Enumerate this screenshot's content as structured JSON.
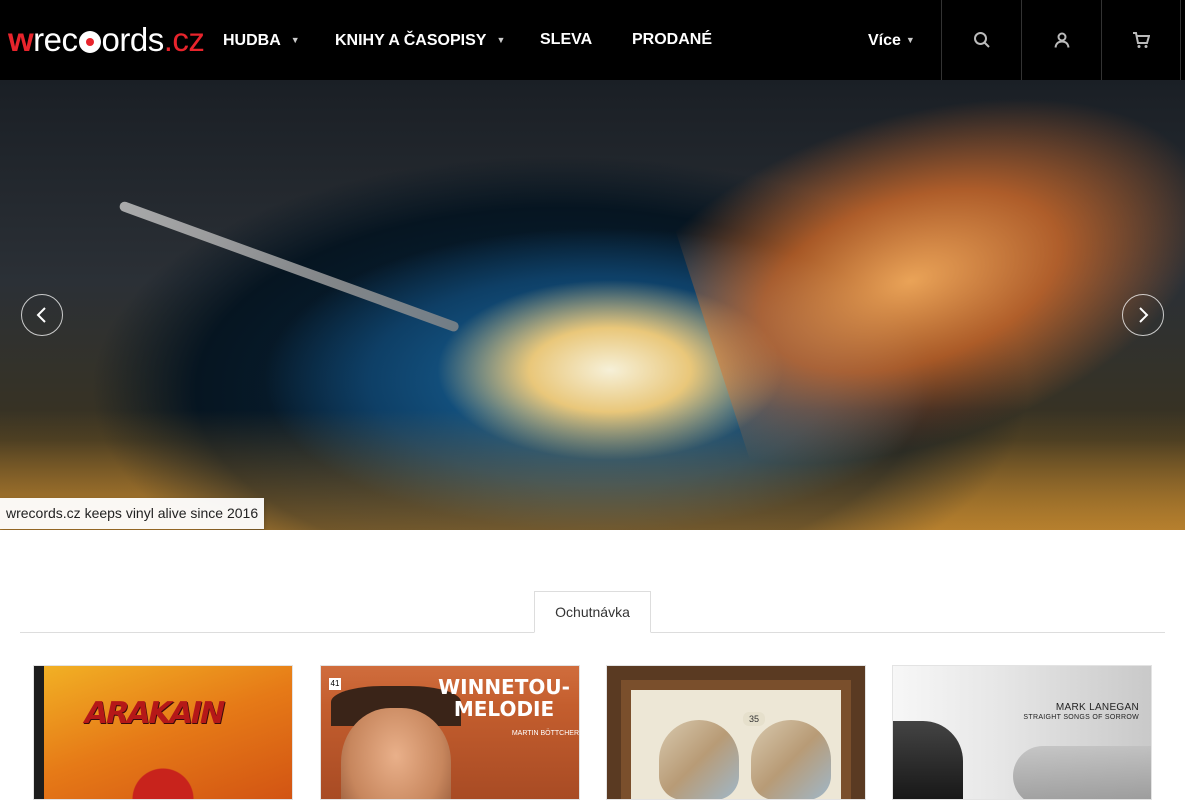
{
  "header": {
    "logo": {
      "w": "w",
      "rec": "rec",
      "ords": "ords",
      "dot_cz": ".cz"
    },
    "nav": [
      {
        "label": "HUDBA",
        "has_dropdown": true
      },
      {
        "label": "KNIHY A ČASOPISY",
        "has_dropdown": true
      },
      {
        "label": "SLEVA",
        "has_dropdown": false
      },
      {
        "label": "PRODANÉ",
        "has_dropdown": false
      }
    ],
    "more_label": "Více",
    "icons": [
      "search-icon",
      "user-icon",
      "cart-icon"
    ]
  },
  "hero": {
    "caption": "wrecords.cz keeps vinyl alive since 2016",
    "prev_icon": "chevron-left-icon",
    "next_icon": "chevron-right-icon"
  },
  "tabs": [
    {
      "label": "Ochutnávka",
      "active": true
    }
  ],
  "products": [
    {
      "cover_text": "ARAKAIN"
    },
    {
      "cover_title": "WINNETOU-MELODIE",
      "cover_subtitle": "MARTIN BÖTTCHER",
      "cover_number": "41"
    },
    {
      "cover_number": "35"
    },
    {
      "cover_artist": "MARK LANEGAN",
      "cover_album": "STRAIGHT SONGS OF SORROW"
    }
  ],
  "colors": {
    "header_bg": "#000000",
    "brand_red": "#e8242c",
    "nav_text": "#ffffff"
  }
}
